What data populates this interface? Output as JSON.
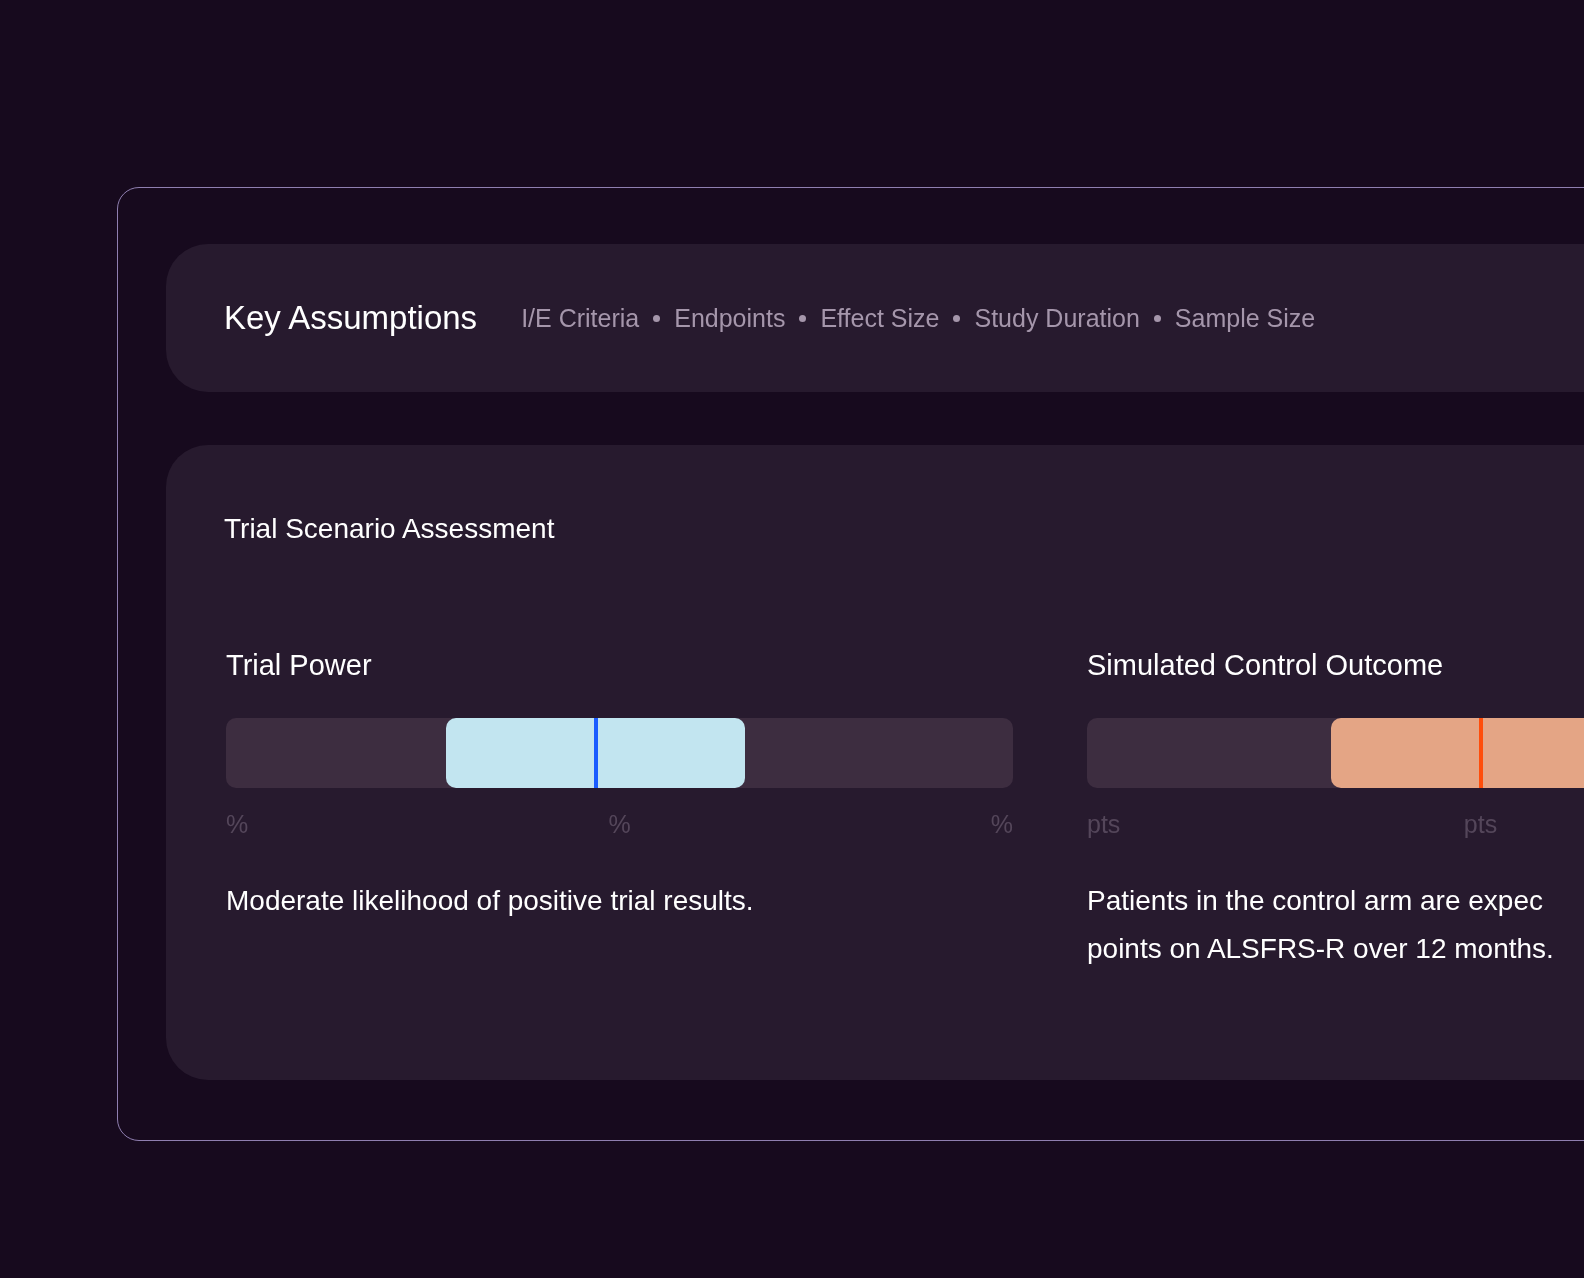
{
  "header": {
    "title": "Key Assumptions",
    "links": [
      "I/E Criteria",
      "Endpoints",
      "Effect Size",
      "Study Duration",
      "Sample Size"
    ]
  },
  "assessment": {
    "title": "Trial Scenario Assessment",
    "metrics": [
      {
        "label": "Trial Power",
        "color": "#c2e5f0",
        "marker": {
          "color": "#1a5cff"
        },
        "level": 0.47,
        "ticks": [
          "%",
          "%",
          "%"
        ],
        "description": "Moderate likelihood of positive trial results."
      },
      {
        "label": "Simulated Control Outcome",
        "color": "#e4a585",
        "marker": {
          "color": "#ff4d0a"
        },
        "level": 0.5,
        "ticks": [
          "pts",
          "pts"
        ],
        "description": "Patients in the control arm are expec\npoints on ALSFRS-R over 12 months."
      }
    ]
  }
}
